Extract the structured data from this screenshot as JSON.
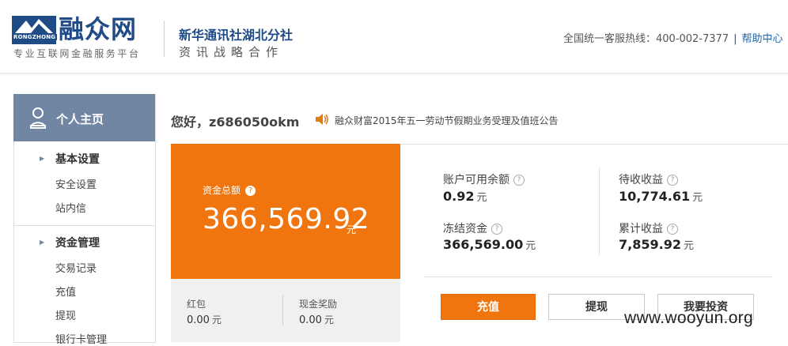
{
  "header": {
    "logo_title": "融众网",
    "logo_sub": "RONGZHONG",
    "logo_slogan": "专业互联网金融服务平台",
    "partner_name": "新华通讯社湖北分社",
    "partner_sub": "资讯战略合作",
    "hotline_label": "全国统一客服热线：400-002-7377",
    "hotline_sep": "|",
    "help_link": "帮助中心"
  },
  "sidebar": {
    "home_label": "个人主页",
    "groups": [
      {
        "title": "基本设置",
        "items": [
          "安全设置",
          "站内信"
        ]
      },
      {
        "title": "资金管理",
        "items": [
          "交易记录",
          "充值",
          "提现",
          "银行卡管理"
        ]
      }
    ]
  },
  "main": {
    "greeting": "您好，z686050okm",
    "notice": "融众财富2015年五一劳动节假期业务受理及值班公告",
    "total_label": "资金总额",
    "total_value": "366,569.92",
    "currency_unit": "元",
    "red_packet_label": "红包",
    "red_packet_value": "0.00",
    "cash_reward_label": "现金奖励",
    "cash_reward_value": "0.00",
    "stats": {
      "available_label": "账户可用余额",
      "available_value": "0.92",
      "pending_income_label": "待收收益",
      "pending_income_value": "10,774.61",
      "frozen_label": "冻结资金",
      "frozen_value": "366,569.00",
      "cumulative_income_label": "累计收益",
      "cumulative_income_value": "7,859.92"
    },
    "buttons": {
      "recharge": "充值",
      "withdraw": "提现",
      "invest": "我要投资"
    }
  },
  "watermark": "www.wooyun.org",
  "colors": {
    "brand_blue": "#1f4b86",
    "accent_orange": "#f1750f",
    "sidebar_header": "#7186a2"
  }
}
